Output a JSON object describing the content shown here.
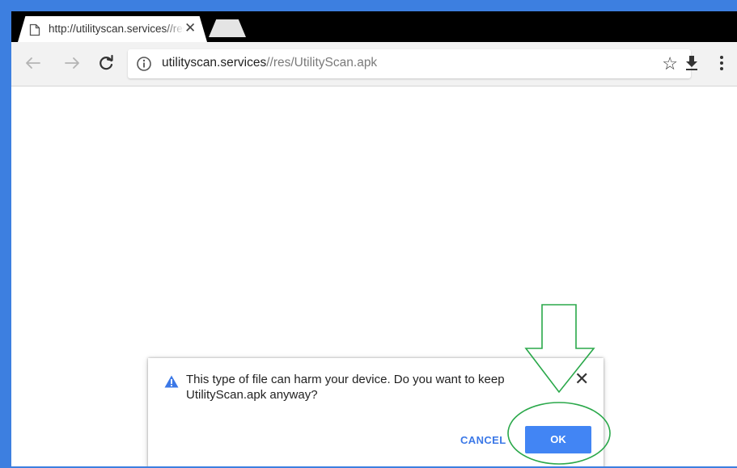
{
  "tab": {
    "title": "http://utilityscan.services//res/UtilityScan.apk",
    "close_icon": "close-icon",
    "page_icon": "page-icon"
  },
  "toolbar": {
    "back_icon": "back-arrow-icon",
    "forward_icon": "forward-arrow-icon",
    "reload_icon": "reload-icon",
    "info_icon": "info-icon",
    "url_host": "utilityscan.services",
    "url_path": "//res/UtilityScan.apk",
    "star_icon": "star-icon",
    "download_icon": "download-icon",
    "menu_icon": "kebab-menu-icon"
  },
  "dialog": {
    "message": "This type of file can harm your device. Do you want to keep UtilityScan.apk anyway?",
    "cancel_label": "CANCEL",
    "ok_label": "OK",
    "warning_icon": "warning-icon",
    "close_icon": "close-icon"
  },
  "colors": {
    "border": "#3d7fe0",
    "accent": "#4285f4",
    "annotation": "#2aa84a"
  }
}
